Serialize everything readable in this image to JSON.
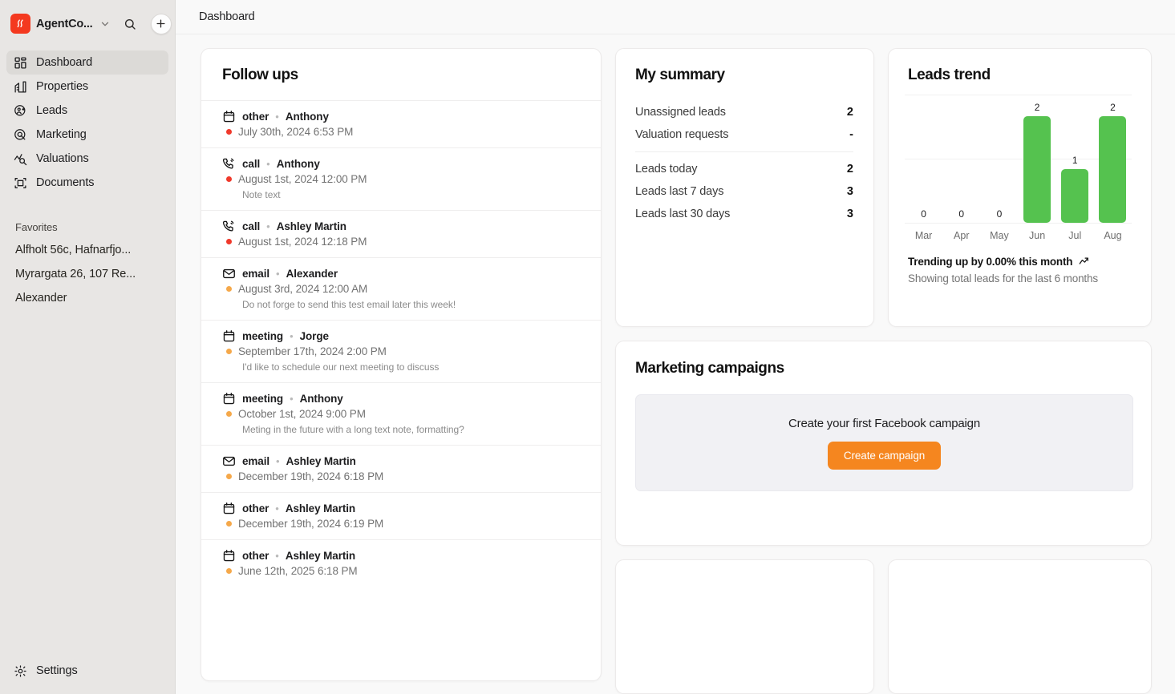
{
  "brand": {
    "name": "AgentCo...",
    "logo_icon": "flame-logo-icon",
    "logo_color": "#f4391f",
    "chevron_icon": "chevron-down-icon",
    "search_icon": "search-icon",
    "add_icon": "plus-icon"
  },
  "sidebar": {
    "items": [
      {
        "label": "Dashboard",
        "icon": "dashboard-grid-icon",
        "active": true
      },
      {
        "label": "Properties",
        "icon": "building-icon",
        "active": false
      },
      {
        "label": "Leads",
        "icon": "person-add-icon",
        "active": false
      },
      {
        "label": "Marketing",
        "icon": "target-icon",
        "active": false
      },
      {
        "label": "Valuations",
        "icon": "trend-search-icon",
        "active": false
      },
      {
        "label": "Documents",
        "icon": "document-frame-icon",
        "active": false
      }
    ],
    "favorites_title": "Favorites",
    "favorites": [
      {
        "label": "Alfholt 56c, Hafnarfjo..."
      },
      {
        "label": "Myrargata 26, 107 Re..."
      },
      {
        "label": "Alexander"
      }
    ],
    "settings": {
      "label": "Settings",
      "icon": "gear-icon"
    }
  },
  "topbar": {
    "title": "Dashboard"
  },
  "followups": {
    "title": "Follow ups",
    "items": [
      {
        "type": "other",
        "icon": "calendar-icon",
        "person": "Anthony",
        "date": "July 30th, 2024 6:53 PM",
        "dot": "#f0392b",
        "note": ""
      },
      {
        "type": "call",
        "icon": "phone-icon",
        "person": "Anthony",
        "date": "August 1st, 2024 12:00 PM",
        "dot": "#f0392b",
        "note": "Note text"
      },
      {
        "type": "call",
        "icon": "phone-icon",
        "person": "Ashley Martin",
        "date": "August 1st, 2024 12:18 PM",
        "dot": "#f0392b",
        "note": ""
      },
      {
        "type": "email",
        "icon": "envelope-icon",
        "person": "Alexander",
        "date": "August 3rd, 2024 12:00 AM",
        "dot": "#f5a84a",
        "note": "Do not forge to send this test email later this week!"
      },
      {
        "type": "meeting",
        "icon": "calendar-icon",
        "person": "Jorge",
        "date": "September 17th, 2024 2:00 PM",
        "dot": "#f5a84a",
        "note": "I'd like to schedule our next meeting to discuss"
      },
      {
        "type": "meeting",
        "icon": "calendar-icon",
        "person": "Anthony",
        "date": "October 1st, 2024 9:00 PM",
        "dot": "#f5a84a",
        "note": "Meting in the future with a long text note, formatting?"
      },
      {
        "type": "email",
        "icon": "envelope-icon",
        "person": "Ashley Martin",
        "date": "December 19th, 2024 6:18 PM",
        "dot": "#f5a84a",
        "note": ""
      },
      {
        "type": "other",
        "icon": "calendar-icon",
        "person": "Ashley Martin",
        "date": "December 19th, 2024 6:19 PM",
        "dot": "#f5a84a",
        "note": ""
      },
      {
        "type": "other",
        "icon": "calendar-icon",
        "person": "Ashley Martin",
        "date": "June 12th, 2025 6:18 PM",
        "dot": "#f5a84a",
        "note": ""
      }
    ],
    "separator": "•"
  },
  "summary": {
    "title": "My summary",
    "group1": [
      {
        "label": "Unassigned leads",
        "value": "2"
      },
      {
        "label": "Valuation requests",
        "value": "-"
      }
    ],
    "group2": [
      {
        "label": "Leads today",
        "value": "2"
      },
      {
        "label": "Leads last 7 days",
        "value": "3"
      },
      {
        "label": "Leads last 30 days",
        "value": "3"
      }
    ]
  },
  "trend": {
    "title": "Leads trend",
    "footer_primary": "Trending up by 0.00% this month",
    "footer_secondary": "Showing total leads for the last 6 months",
    "trend_icon": "trending-up-icon",
    "bar_color": "#55c24f"
  },
  "chart_data": {
    "type": "bar",
    "title": "Leads trend",
    "categories": [
      "Mar",
      "Apr",
      "May",
      "Jun",
      "Jul",
      "Aug"
    ],
    "values": [
      0,
      0,
      0,
      2,
      1,
      2
    ],
    "data_labels": [
      "0",
      "0",
      "0",
      "2",
      "1",
      "2"
    ],
    "xlabel": "",
    "ylabel": "",
    "ylim": [
      0,
      2.4
    ],
    "grid": true,
    "gridline_count": 3,
    "legend": "none",
    "series_color": "#55c24f"
  },
  "marketing": {
    "title": "Marketing campaigns",
    "empty_text": "Create your first Facebook campaign",
    "button_label": "Create campaign",
    "button_color": "#f5861f"
  },
  "placeholder_cards": [
    {
      "label": ""
    },
    {
      "label": ""
    }
  ]
}
